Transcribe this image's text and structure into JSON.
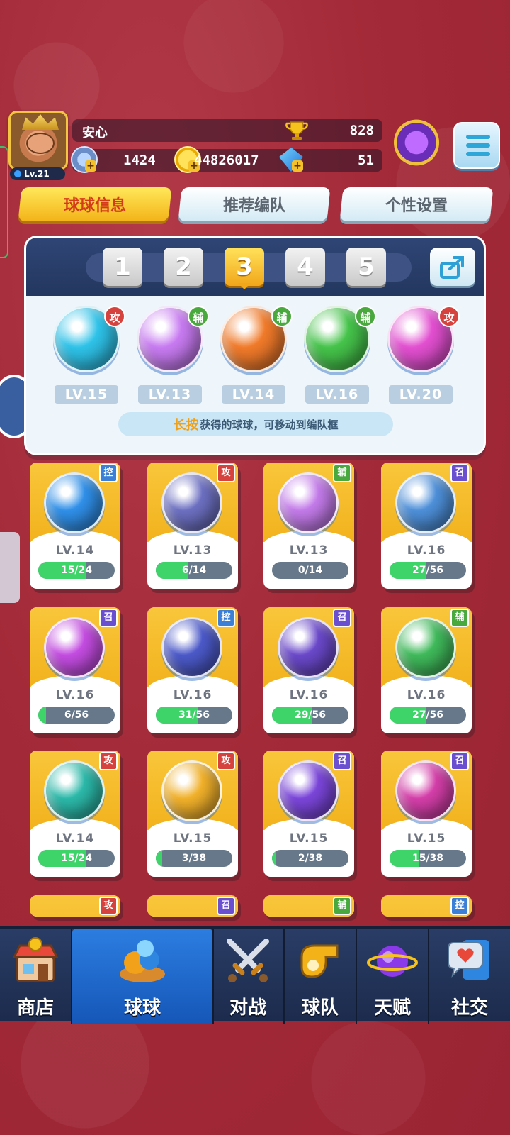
{
  "player": {
    "name": "安心",
    "level_label": "Lv.21",
    "trophy_score": "828",
    "stars": "1424",
    "coins": "44826017",
    "gems": "51"
  },
  "tabs": [
    "球球信息",
    "推荐编队",
    "个性设置"
  ],
  "team": {
    "numbers": [
      "1",
      "2",
      "3",
      "4",
      "5"
    ],
    "selected": "3",
    "slots": [
      {
        "tag": "攻",
        "tag_type": "atk",
        "level": "LV.15",
        "color": "#2ec2e8",
        "icon": "sword-orb-icon"
      },
      {
        "tag": "辅",
        "tag_type": "sup",
        "level": "LV.13",
        "color": "#c77af0",
        "icon": "people-orb-icon"
      },
      {
        "tag": "辅",
        "tag_type": "sup",
        "level": "LV.14",
        "color": "#f07a2a",
        "icon": "phoenix-orb-icon"
      },
      {
        "tag": "辅",
        "tag_type": "sup",
        "level": "LV.16",
        "color": "#45c34a",
        "icon": "arrow-star-orb-icon"
      },
      {
        "tag": "攻",
        "tag_type": "atk",
        "level": "LV.20",
        "color": "#e24fd0",
        "icon": "shield-orb-icon"
      }
    ],
    "hint_highlight": "长按",
    "hint_text": "获得的球球，可移动到编队框"
  },
  "balls": [
    {
      "tag": "控",
      "tag_type": "ctl",
      "level": "LV.14",
      "progress": "15/24",
      "fill": 0.62,
      "color": "#2f8fe8",
      "icon": "cloud-orb-icon"
    },
    {
      "tag": "攻",
      "tag_type": "atk",
      "level": "LV.13",
      "progress": "6/14",
      "fill": 0.43,
      "color": "#6c6fc0",
      "icon": "wall-orb-icon"
    },
    {
      "tag": "辅",
      "tag_type": "sup",
      "level": "LV.13",
      "progress": "0/14",
      "fill": 0,
      "color": "#c27ae8",
      "icon": "people-orb-icon"
    },
    {
      "tag": "召",
      "tag_type": "sum",
      "level": "LV.16",
      "progress": "27/56",
      "fill": 0.48,
      "color": "#4d8fd8",
      "icon": "vortex-orb-icon"
    },
    {
      "tag": "召",
      "tag_type": "sum",
      "level": "LV.16",
      "progress": "6/56",
      "fill": 0.1,
      "color": "#c34ce0",
      "icon": "mushroom-orb-icon"
    },
    {
      "tag": "控",
      "tag_type": "ctl",
      "level": "LV.16",
      "progress": "31/56",
      "fill": 0.55,
      "color": "#4b59c8",
      "icon": "clock-orb-icon"
    },
    {
      "tag": "召",
      "tag_type": "sum",
      "level": "LV.16",
      "progress": "29/56",
      "fill": 0.52,
      "color": "#6a48c9",
      "icon": "ghost-orb-icon"
    },
    {
      "tag": "辅",
      "tag_type": "sup",
      "level": "LV.16",
      "progress": "27/56",
      "fill": 0.48,
      "color": "#3fb95a",
      "icon": "arrow-star-orb-icon"
    },
    {
      "tag": "攻",
      "tag_type": "atk",
      "level": "LV.14",
      "progress": "15/24",
      "fill": 0.62,
      "color": "#2bb8a8",
      "icon": "tornado-orb-icon"
    },
    {
      "tag": "攻",
      "tag_type": "atk",
      "level": "LV.15",
      "progress": "3/38",
      "fill": 0.08,
      "color": "#f0b02a",
      "icon": "shuriken-orb-icon"
    },
    {
      "tag": "召",
      "tag_type": "sum",
      "level": "LV.15",
      "progress": "2/38",
      "fill": 0.05,
      "color": "#7a45d8",
      "icon": "planet-orb-icon"
    },
    {
      "tag": "召",
      "tag_type": "sum",
      "level": "LV.15",
      "progress": "15/38",
      "fill": 0.39,
      "color": "#d33ea8",
      "icon": "blade-orb-icon"
    }
  ],
  "partial_tags": [
    {
      "tag": "攻",
      "tag_type": "atk"
    },
    {
      "tag": "召",
      "tag_type": "sum"
    },
    {
      "tag": "辅",
      "tag_type": "sup"
    },
    {
      "tag": "控",
      "tag_type": "ctl"
    }
  ],
  "nav": [
    {
      "label": "商店",
      "icon": "shop-icon"
    },
    {
      "label": "球球",
      "icon": "balls-icon"
    },
    {
      "label": "对战",
      "icon": "crossed-swords-icon"
    },
    {
      "label": "球队",
      "icon": "whistle-icon"
    },
    {
      "label": "天赋",
      "icon": "planet-icon"
    },
    {
      "label": "社交",
      "icon": "chat-heart-icon"
    }
  ],
  "nav_active": "球球"
}
